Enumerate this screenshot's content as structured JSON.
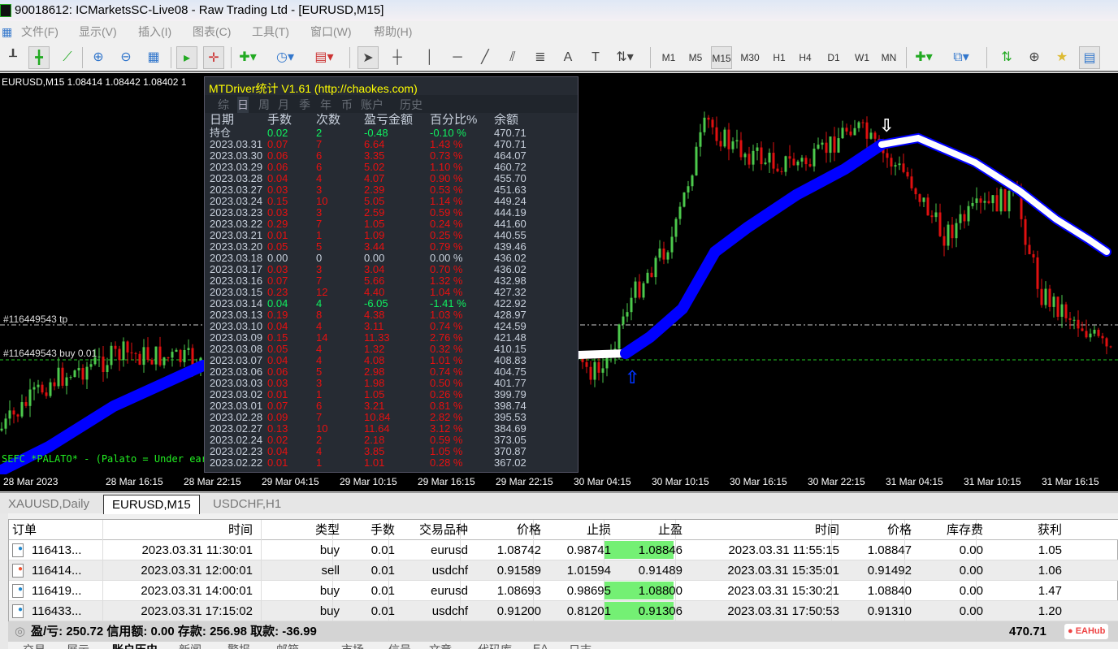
{
  "window": {
    "title": "90018612: ICMarketsSC-Live08 - Raw Trading Ltd - [EURUSD,M15]"
  },
  "menu": [
    "文件(F)",
    "显示(V)",
    "插入(I)",
    "图表(C)",
    "工具(T)",
    "窗口(W)",
    "帮助(H)"
  ],
  "toolbar": {
    "timeframes": [
      "M1",
      "M5",
      "M15",
      "M30",
      "H1",
      "H4",
      "D1",
      "W1",
      "MN"
    ],
    "active_timeframe": "M15"
  },
  "chart": {
    "info": "EURUSD,M15  1.08414 1.08442 1.08402 1",
    "tp_label": "#116449543 tp",
    "buy_label": "#116449543 buy 0.01",
    "comment": "SEFC *PALATO* - (Palato = Under eart",
    "time_labels": [
      "28 Mar 2023",
      "28 Mar 16:15",
      "28 Mar 22:15",
      "29 Mar 04:15",
      "29 Mar 10:15",
      "29 Mar 16:15",
      "29 Mar 22:15",
      "30 Mar 04:15",
      "30 Mar 10:15",
      "30 Mar 16:15",
      "30 Mar 22:15",
      "31 Mar 04:15",
      "31 Mar 10:15",
      "31 Mar 16:15",
      "31 Mar"
    ],
    "colors": {
      "background": "#000000",
      "bull": "#4cc94c",
      "bear": "#e01010",
      "ma": "#0000ff",
      "ma_down": "#ffffff"
    }
  },
  "stats": {
    "title": "MTDriver统计  V1.61  (http://chaokes.com)",
    "tabs": [
      "综",
      "日",
      "周",
      "月",
      "季",
      "年",
      "币",
      "账户",
      "历史"
    ],
    "active_tab": "日",
    "headers": [
      "日期",
      "手数",
      "次数",
      "盈亏金额",
      "百分比%",
      "余额"
    ],
    "rows": [
      [
        "持仓",
        "0.02",
        "2",
        "-0.48",
        "-0.10 %",
        "470.71"
      ],
      [
        "2023.03.31",
        "0.07",
        "7",
        "6.64",
        "1.43 %",
        "470.71"
      ],
      [
        "2023.03.30",
        "0.06",
        "6",
        "3.35",
        "0.73 %",
        "464.07"
      ],
      [
        "2023.03.29",
        "0.06",
        "6",
        "5.02",
        "1.10 %",
        "460.72"
      ],
      [
        "2023.03.28",
        "0.04",
        "4",
        "4.07",
        "0.90 %",
        "455.70"
      ],
      [
        "2023.03.27",
        "0.03",
        "3",
        "2.39",
        "0.53 %",
        "451.63"
      ],
      [
        "2023.03.24",
        "0.15",
        "10",
        "5.05",
        "1.14 %",
        "449.24"
      ],
      [
        "2023.03.23",
        "0.03",
        "3",
        "2.59",
        "0.59 %",
        "444.19"
      ],
      [
        "2023.03.22",
        "0.29",
        "7",
        "1.05",
        "0.24 %",
        "441.60"
      ],
      [
        "2023.03.21",
        "0.01",
        "1",
        "1.09",
        "0.25 %",
        "440.55"
      ],
      [
        "2023.03.20",
        "0.05",
        "5",
        "3.44",
        "0.79 %",
        "439.46"
      ],
      [
        "2023.03.18",
        "0.00",
        "0",
        "0.00",
        "0.00 %",
        "436.02"
      ],
      [
        "2023.03.17",
        "0.03",
        "3",
        "3.04",
        "0.70 %",
        "436.02"
      ],
      [
        "2023.03.16",
        "0.07",
        "7",
        "5.66",
        "1.32 %",
        "432.98"
      ],
      [
        "2023.03.15",
        "0.23",
        "12",
        "4.40",
        "1.04 %",
        "427.32"
      ],
      [
        "2023.03.14",
        "0.04",
        "4",
        "-6.05",
        "-1.41 %",
        "422.92"
      ],
      [
        "2023.03.13",
        "0.19",
        "8",
        "4.38",
        "1.03 %",
        "428.97"
      ],
      [
        "2023.03.10",
        "0.04",
        "4",
        "3.11",
        "0.74 %",
        "424.59"
      ],
      [
        "2023.03.09",
        "0.15",
        "14",
        "11.33",
        "2.76 %",
        "421.48"
      ],
      [
        "2023.03.08",
        "0.05",
        "4",
        "1.32",
        "0.32 %",
        "410.15"
      ],
      [
        "2023.03.07",
        "0.04",
        "4",
        "4.08",
        "1.01 %",
        "408.83"
      ],
      [
        "2023.03.06",
        "0.06",
        "5",
        "2.98",
        "0.74 %",
        "404.75"
      ],
      [
        "2023.03.03",
        "0.03",
        "3",
        "1.98",
        "0.50 %",
        "401.77"
      ],
      [
        "2023.03.02",
        "0.01",
        "1",
        "1.05",
        "0.26 %",
        "399.79"
      ],
      [
        "2023.03.01",
        "0.07",
        "6",
        "3.21",
        "0.81 %",
        "398.74"
      ],
      [
        "2023.02.28",
        "0.09",
        "7",
        "10.84",
        "2.82 %",
        "395.53"
      ],
      [
        "2023.02.27",
        "0.13",
        "10",
        "11.64",
        "3.12 %",
        "384.69"
      ],
      [
        "2023.02.24",
        "0.02",
        "2",
        "2.18",
        "0.59 %",
        "373.05"
      ],
      [
        "2023.02.23",
        "0.04",
        "4",
        "3.85",
        "1.05 %",
        "370.87"
      ],
      [
        "2023.02.22",
        "0.01",
        "1",
        "1.01",
        "0.28 %",
        "367.02"
      ]
    ],
    "colors": {
      "label": "#c8d0dc",
      "profit": "#e81010",
      "loss": "#10f060",
      "title": "#ffff00"
    }
  },
  "chart_tabs": [
    "XAUUSD,Daily",
    "EURUSD,M15",
    "USDCHF,H1"
  ],
  "active_chart_tab": "EURUSD,M15",
  "terminal": {
    "headers": [
      "订单",
      "时间",
      "类型",
      "手数",
      "交易品种",
      "价格",
      "止损",
      "止盈",
      "时间",
      "价格",
      "库存费",
      "获利"
    ],
    "rows": [
      [
        "116413...",
        "2023.03.31 11:30:01",
        "buy",
        "0.01",
        "eurusd",
        "1.08742",
        "0.98741",
        "1.08846",
        "2023.03.31 11:55:15",
        "1.08847",
        "0.00",
        "1.05"
      ],
      [
        "116414...",
        "2023.03.31 12:00:01",
        "sell",
        "0.01",
        "usdchf",
        "0.91589",
        "1.01594",
        "0.91489",
        "2023.03.31 15:35:01",
        "0.91492",
        "0.00",
        "1.06"
      ],
      [
        "116419...",
        "2023.03.31 14:00:01",
        "buy",
        "0.01",
        "eurusd",
        "1.08693",
        "0.98695",
        "1.08800",
        "2023.03.31 15:30:21",
        "1.08840",
        "0.00",
        "1.47"
      ],
      [
        "116433...",
        "2023.03.31 17:15:02",
        "buy",
        "0.01",
        "usdchf",
        "0.91200",
        "0.81201",
        "0.91306",
        "2023.03.31 17:50:53",
        "0.91310",
        "0.00",
        "1.20"
      ]
    ],
    "tp_hit": [
      true,
      false,
      true,
      true
    ],
    "summary": "盈/亏: 250.72  信用额: 0.00  存款: 256.98  取款: -36.99",
    "total": "470.71"
  },
  "bottom_tabs": [
    "交易",
    "展示",
    "账户历史",
    "新闻",
    "警报",
    "邮箱",
    "市场",
    "信号",
    "文章",
    "代码库",
    "EA",
    "日志"
  ],
  "active_bottom_tab": "账户历史",
  "watermark": "EAHub"
}
